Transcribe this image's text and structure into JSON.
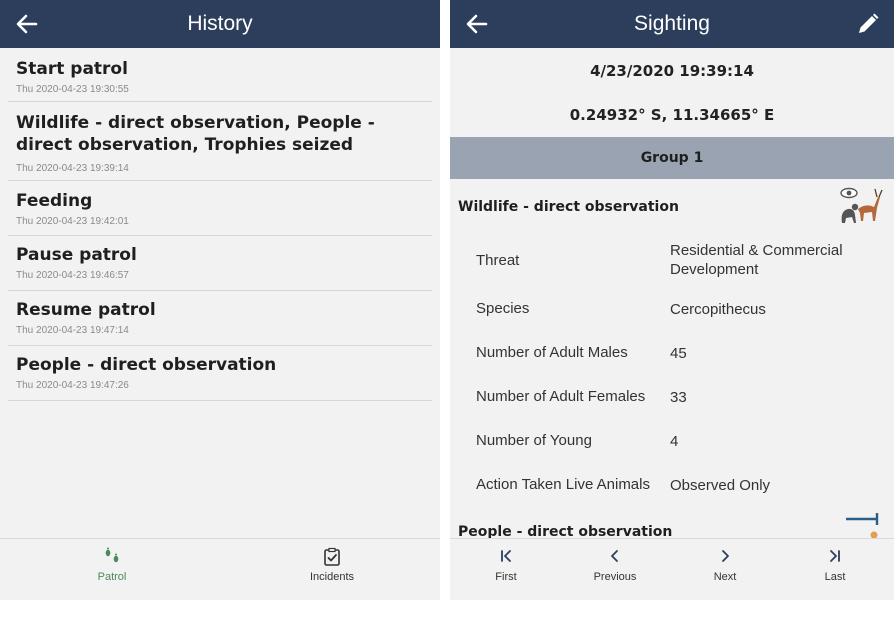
{
  "history": {
    "title": "History",
    "items": [
      {
        "name": "Start patrol",
        "time": "Thu 2020-04-23 19:30:55"
      },
      {
        "name": "Wildlife - direct observation, People - direct observation, Trophies seized",
        "time": "Thu 2020-04-23 19:39:14"
      },
      {
        "name": "Feeding",
        "time": "Thu 2020-04-23 19:42:01"
      },
      {
        "name": "Pause patrol",
        "time": "Thu 2020-04-23 19:46:57"
      },
      {
        "name": "Resume patrol",
        "time": "Thu 2020-04-23 19:47:14"
      },
      {
        "name": "People - direct observation",
        "time": "Thu 2020-04-23 19:47:26"
      }
    ],
    "tabs": [
      {
        "label": "Patrol",
        "icon": "footprints-icon",
        "active": true
      },
      {
        "label": "Incidents",
        "icon": "clipboard-check-icon",
        "active": false
      }
    ],
    "accent": "#4a8a5a"
  },
  "sighting": {
    "title": "Sighting",
    "datetime": "4/23/2020 19:39:14",
    "location": "0.24932° S, 11.34665° E",
    "group": "Group 1",
    "category": "Wildlife - direct observation",
    "fields": [
      {
        "label": "Threat",
        "value": "Residential & Commercial Development"
      },
      {
        "label": "Species",
        "value": "Cercopithecus"
      },
      {
        "label": "Number of Adult Males",
        "value": "45"
      },
      {
        "label": "Number of Adult Females",
        "value": "33"
      },
      {
        "label": "Number of Young",
        "value": "4"
      },
      {
        "label": "Action Taken Live Animals",
        "value": "Observed Only"
      }
    ],
    "next_category": "People - direct observation",
    "nav": [
      {
        "label": "First",
        "icon": "first-icon"
      },
      {
        "label": "Previous",
        "icon": "previous-icon"
      },
      {
        "label": "Next",
        "icon": "next-icon"
      },
      {
        "label": "Last",
        "icon": "last-icon"
      }
    ]
  },
  "colors": {
    "appbar": "#2c3e5c",
    "group_band": "#9aa3b2",
    "background": "#f2f2f2"
  }
}
